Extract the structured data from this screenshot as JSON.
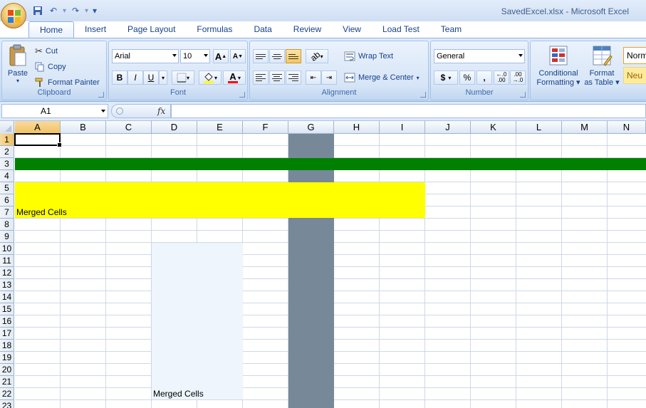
{
  "window": {
    "title": "SavedExcel.xlsx - Microsoft Excel"
  },
  "tabs": [
    "Home",
    "Insert",
    "Page Layout",
    "Formulas",
    "Data",
    "Review",
    "View",
    "Load Test",
    "Team"
  ],
  "ribbon": {
    "clipboard": {
      "label": "Clipboard",
      "paste": "Paste",
      "cut": "Cut",
      "copy": "Copy",
      "format_painter": "Format Painter"
    },
    "font": {
      "label": "Font",
      "font_name": "Arial",
      "font_size": "10",
      "bold": "B",
      "italic": "I",
      "underline": "U",
      "font_color_letter": "A",
      "grow": "A",
      "shrink": "A"
    },
    "alignment": {
      "label": "Alignment",
      "wrap_text": "Wrap Text",
      "merge_center": "Merge & Center"
    },
    "number": {
      "label": "Number",
      "format": "General",
      "currency": "$",
      "percent": "%",
      "comma": ",",
      "inc_decimal": "←.0\n.00",
      "dec_decimal": ".00\n→.0"
    },
    "styles": {
      "conditional_formatting_1": "Conditional",
      "conditional_formatting_2": "Formatting",
      "format_table_1": "Format",
      "format_table_2": "as Table",
      "normal": "Norm",
      "neutral": "Neu"
    }
  },
  "formula_bar": {
    "name_box": "A1",
    "fx": "fx",
    "value": ""
  },
  "sheet": {
    "columns": [
      "A",
      "B",
      "C",
      "D",
      "E",
      "F",
      "G",
      "H",
      "I",
      "J",
      "K",
      "L",
      "M",
      "N"
    ],
    "rows": [
      "1",
      "2",
      "3",
      "4",
      "5",
      "6",
      "7",
      "8",
      "9",
      "10",
      "11",
      "12",
      "13",
      "14",
      "15",
      "16",
      "17",
      "18",
      "19",
      "20",
      "21",
      "22",
      "23"
    ],
    "selected_cell": "A1",
    "merged_cell_1_text": "Merged Cells",
    "merged_cell_2_text": "Merged Cells"
  },
  "colors": {
    "green_row": "#008000",
    "yellow_merge": "#ffff00",
    "gray_column": "#778899",
    "light_merge": "#eef5fc"
  }
}
